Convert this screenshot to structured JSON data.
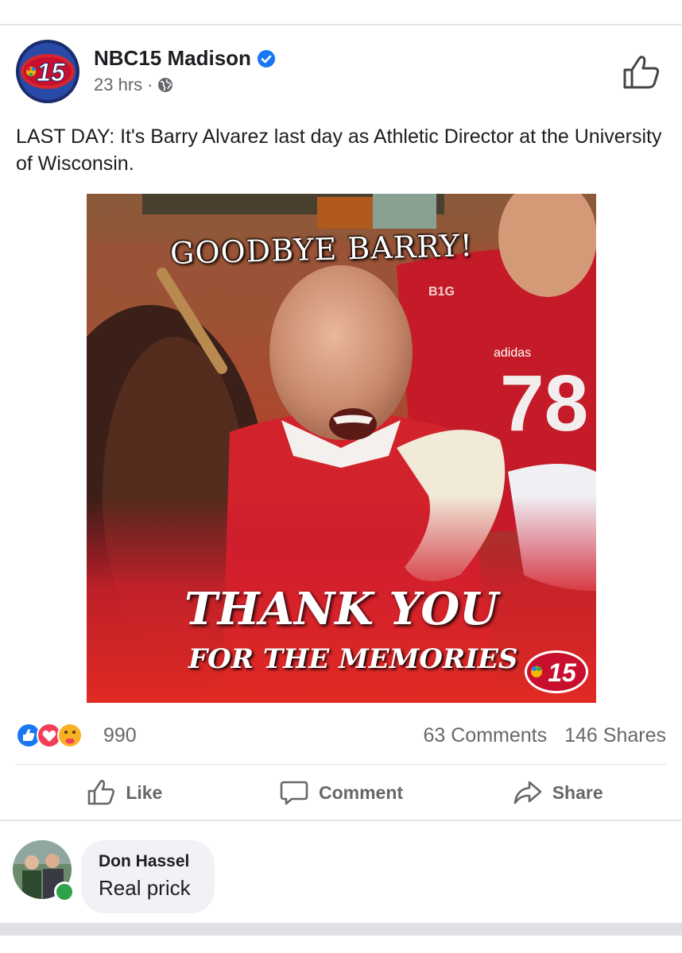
{
  "post": {
    "page_name": "NBC15 Madison",
    "verified_icon": "verified-badge-icon",
    "time": "23 hrs",
    "separator": "·",
    "privacy_icon": "globe-icon",
    "header_action_icon": "thumbs-up-icon",
    "text": "LAST DAY: It's Barry Alvarez last day as Athletic Director at the University of Wisconsin.",
    "avatar_logo_text": "15"
  },
  "photo": {
    "caption_top": "GOODBYE BARRY!",
    "caption_main": "THANK YOU",
    "caption_sub": "FOR THE MEMORIES",
    "logo_text": "15",
    "jersey_number": "78",
    "jersey_brand": "adidas",
    "jersey_conference": "B1G"
  },
  "reactions": {
    "icons": [
      "like-reaction-icon",
      "love-reaction-icon",
      "care-reaction-icon"
    ],
    "count": "990",
    "comments": "63 Comments",
    "shares": "146 Shares"
  },
  "actions": {
    "like_label": "Like",
    "comment_label": "Comment",
    "share_label": "Share"
  },
  "comment": {
    "author": "Don Hassel",
    "text": "Real prick"
  },
  "colors": {
    "facebook_blue": "#1877f2",
    "text_secondary": "#65676b",
    "bubble": "#f0f2f5",
    "online": "#31a24c",
    "badger_red": "#c8102e"
  }
}
